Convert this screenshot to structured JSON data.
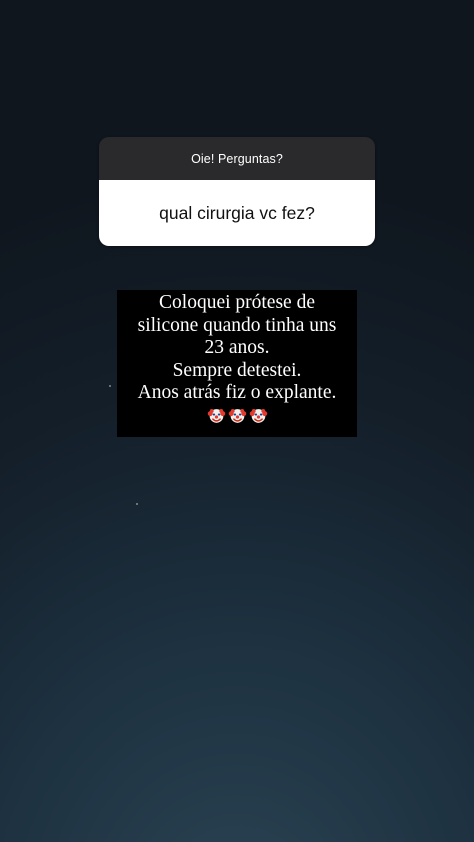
{
  "question_sticker": {
    "header": "Oie! Perguntas?",
    "question": "qual cirurgia vc fez?"
  },
  "answer": {
    "lines": [
      "Coloquei prótese de",
      "silicone quando tinha uns",
      "23 anos.",
      "Sempre detestei.",
      "Anos atrás fiz o explante."
    ],
    "emoji": [
      "clown-face-icon",
      "clown-face-icon",
      "clown-face-icon"
    ]
  },
  "colors": {
    "background_top": "#0f161e",
    "background_bottom": "#2b4454",
    "sticker_header": "#2a2a2c",
    "sticker_body": "#ffffff",
    "answer_box": "#000000"
  }
}
